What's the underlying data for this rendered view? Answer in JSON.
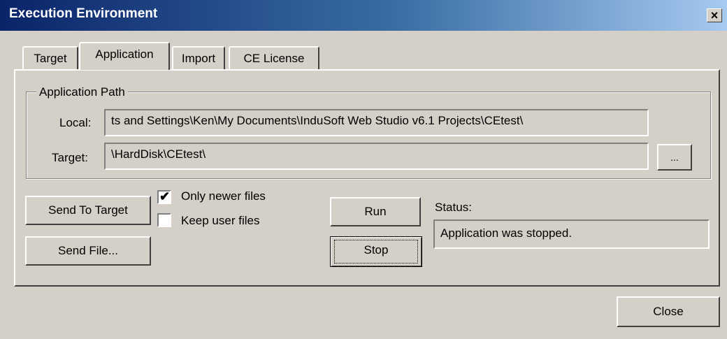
{
  "window": {
    "title": "Execution Environment",
    "close_glyph": "✕"
  },
  "tabs": [
    {
      "label": "Target",
      "active": false
    },
    {
      "label": "Application",
      "active": true
    },
    {
      "label": "Import",
      "active": false
    },
    {
      "label": "CE License",
      "active": false
    }
  ],
  "application_path": {
    "group_label": "Application Path",
    "local_label": "Local:",
    "local_value": "ts and Settings\\Ken\\My Documents\\InduSoft Web Studio v6.1 Projects\\CEtest\\",
    "target_label": "Target:",
    "target_value": "\\HardDisk\\CEtest\\",
    "browse_label": "..."
  },
  "actions": {
    "send_to_target": "Send To Target",
    "send_file": "Send File...",
    "only_newer": {
      "label": "Only newer files",
      "checked": true
    },
    "keep_user": {
      "label": "Keep user files",
      "checked": false
    },
    "run": "Run",
    "stop": "Stop"
  },
  "status": {
    "label": "Status:",
    "value": "Application was stopped."
  },
  "footer": {
    "close": "Close"
  }
}
